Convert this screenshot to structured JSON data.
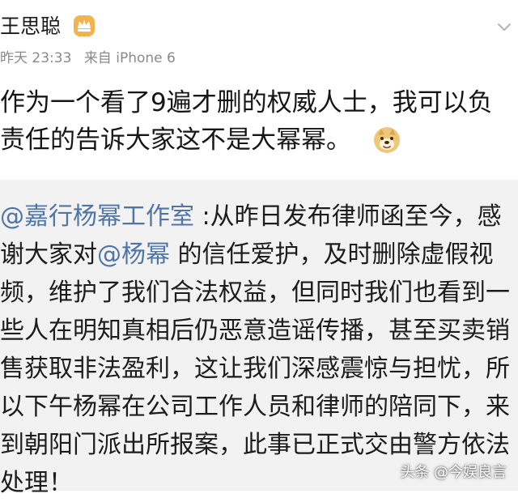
{
  "user": {
    "name": "王思聪",
    "badge_icon": "crown-badge-icon"
  },
  "meta": {
    "time": "昨天 23:33",
    "source": "来自 iPhone 6"
  },
  "post": {
    "line1": "作为一个看了9遍才删的权威人士，我可以负",
    "line2": "责任的告诉大家这不是大幂幂。",
    "emoji": "doge-icon"
  },
  "quote": {
    "line1_mention": "@嘉行杨幂工作室",
    "line1_rest": " :从昨日发布律师函至今，感",
    "line2_prefix": "谢大家对",
    "line2_mention": "@杨幂",
    "line2_rest": " 的信任爱护，及时删除虚假视",
    "line3": "频，维护了我们合法权益，但同时我们也看到一",
    "line4": "些人在明知真相后仍恶意造谣传播，甚至买卖销",
    "line5": "售获取非法盈利，这让我们深感震惊与担忧，所",
    "line6": "以下午杨幂在公司工作人员和律师的陪同下，来",
    "line7": "到朝阳门派出所报案，此事已正式交由警方依法",
    "line8": "处理！"
  },
  "watermark": {
    "text": "头条 @今娱良言"
  },
  "colors": {
    "mention": "#4f74a6",
    "quote_bg": "#f2f2f2",
    "meta_text": "#8a8a8a"
  }
}
